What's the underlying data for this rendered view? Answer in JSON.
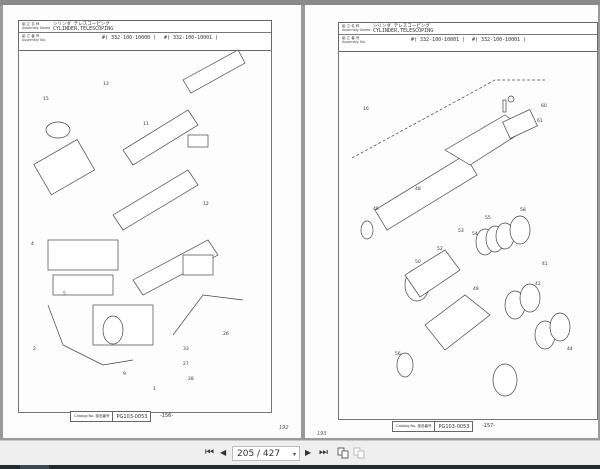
{
  "viewer": {
    "current_page": "205 / 427",
    "controls": {
      "first": "⏮",
      "prev": "◀",
      "next": "▶",
      "last": "⏭",
      "dropdown": "▾"
    }
  },
  "pages": [
    {
      "header": {
        "name_label_jp": "組 立 名 称",
        "name_label_en": "Assembly Name",
        "name_jp": "シリンダ テレスコーピング",
        "name_en": "CYLINDER,TELESCOPING",
        "no_label_jp": "組 立 番 号",
        "no_label_en": "Assembly No.",
        "asm_no_1": "#( 332-100-10000 )",
        "asm_no_2": "#( 332-100-10001 )"
      },
      "footer": {
        "catalog_label": "Catalog No. 部品番号",
        "catalog_no": "PG103-0053",
        "page": "-156-"
      },
      "handwritten": "192",
      "callouts": [
        "15",
        "11",
        "4",
        "12",
        "26",
        "33",
        "27",
        "28",
        "2",
        "9",
        "1",
        "5",
        "13"
      ]
    },
    {
      "header": {
        "name_label_jp": "組 立 名 称",
        "name_label_en": "Assembly Name",
        "name_jp": "シリンダ テレスコーピング",
        "name_en": "CYLINDER,TELESCOPING",
        "no_label_jp": "組 立 番 号",
        "no_label_en": "Assembly No.",
        "asm_no_1": "#( 332-100-10001 )",
        "asm_no_2": "#( 332-100-10001 )"
      },
      "footer": {
        "catalog_label": "Catalog No. 部品番号",
        "catalog_no": "PG103-0053",
        "page": "-157-"
      },
      "handwritten": "193",
      "callouts": [
        "16",
        "60",
        "61",
        "48",
        "46",
        "53",
        "54",
        "55",
        "52",
        "58",
        "50",
        "41",
        "49",
        "42",
        "56",
        "44"
      ]
    }
  ]
}
